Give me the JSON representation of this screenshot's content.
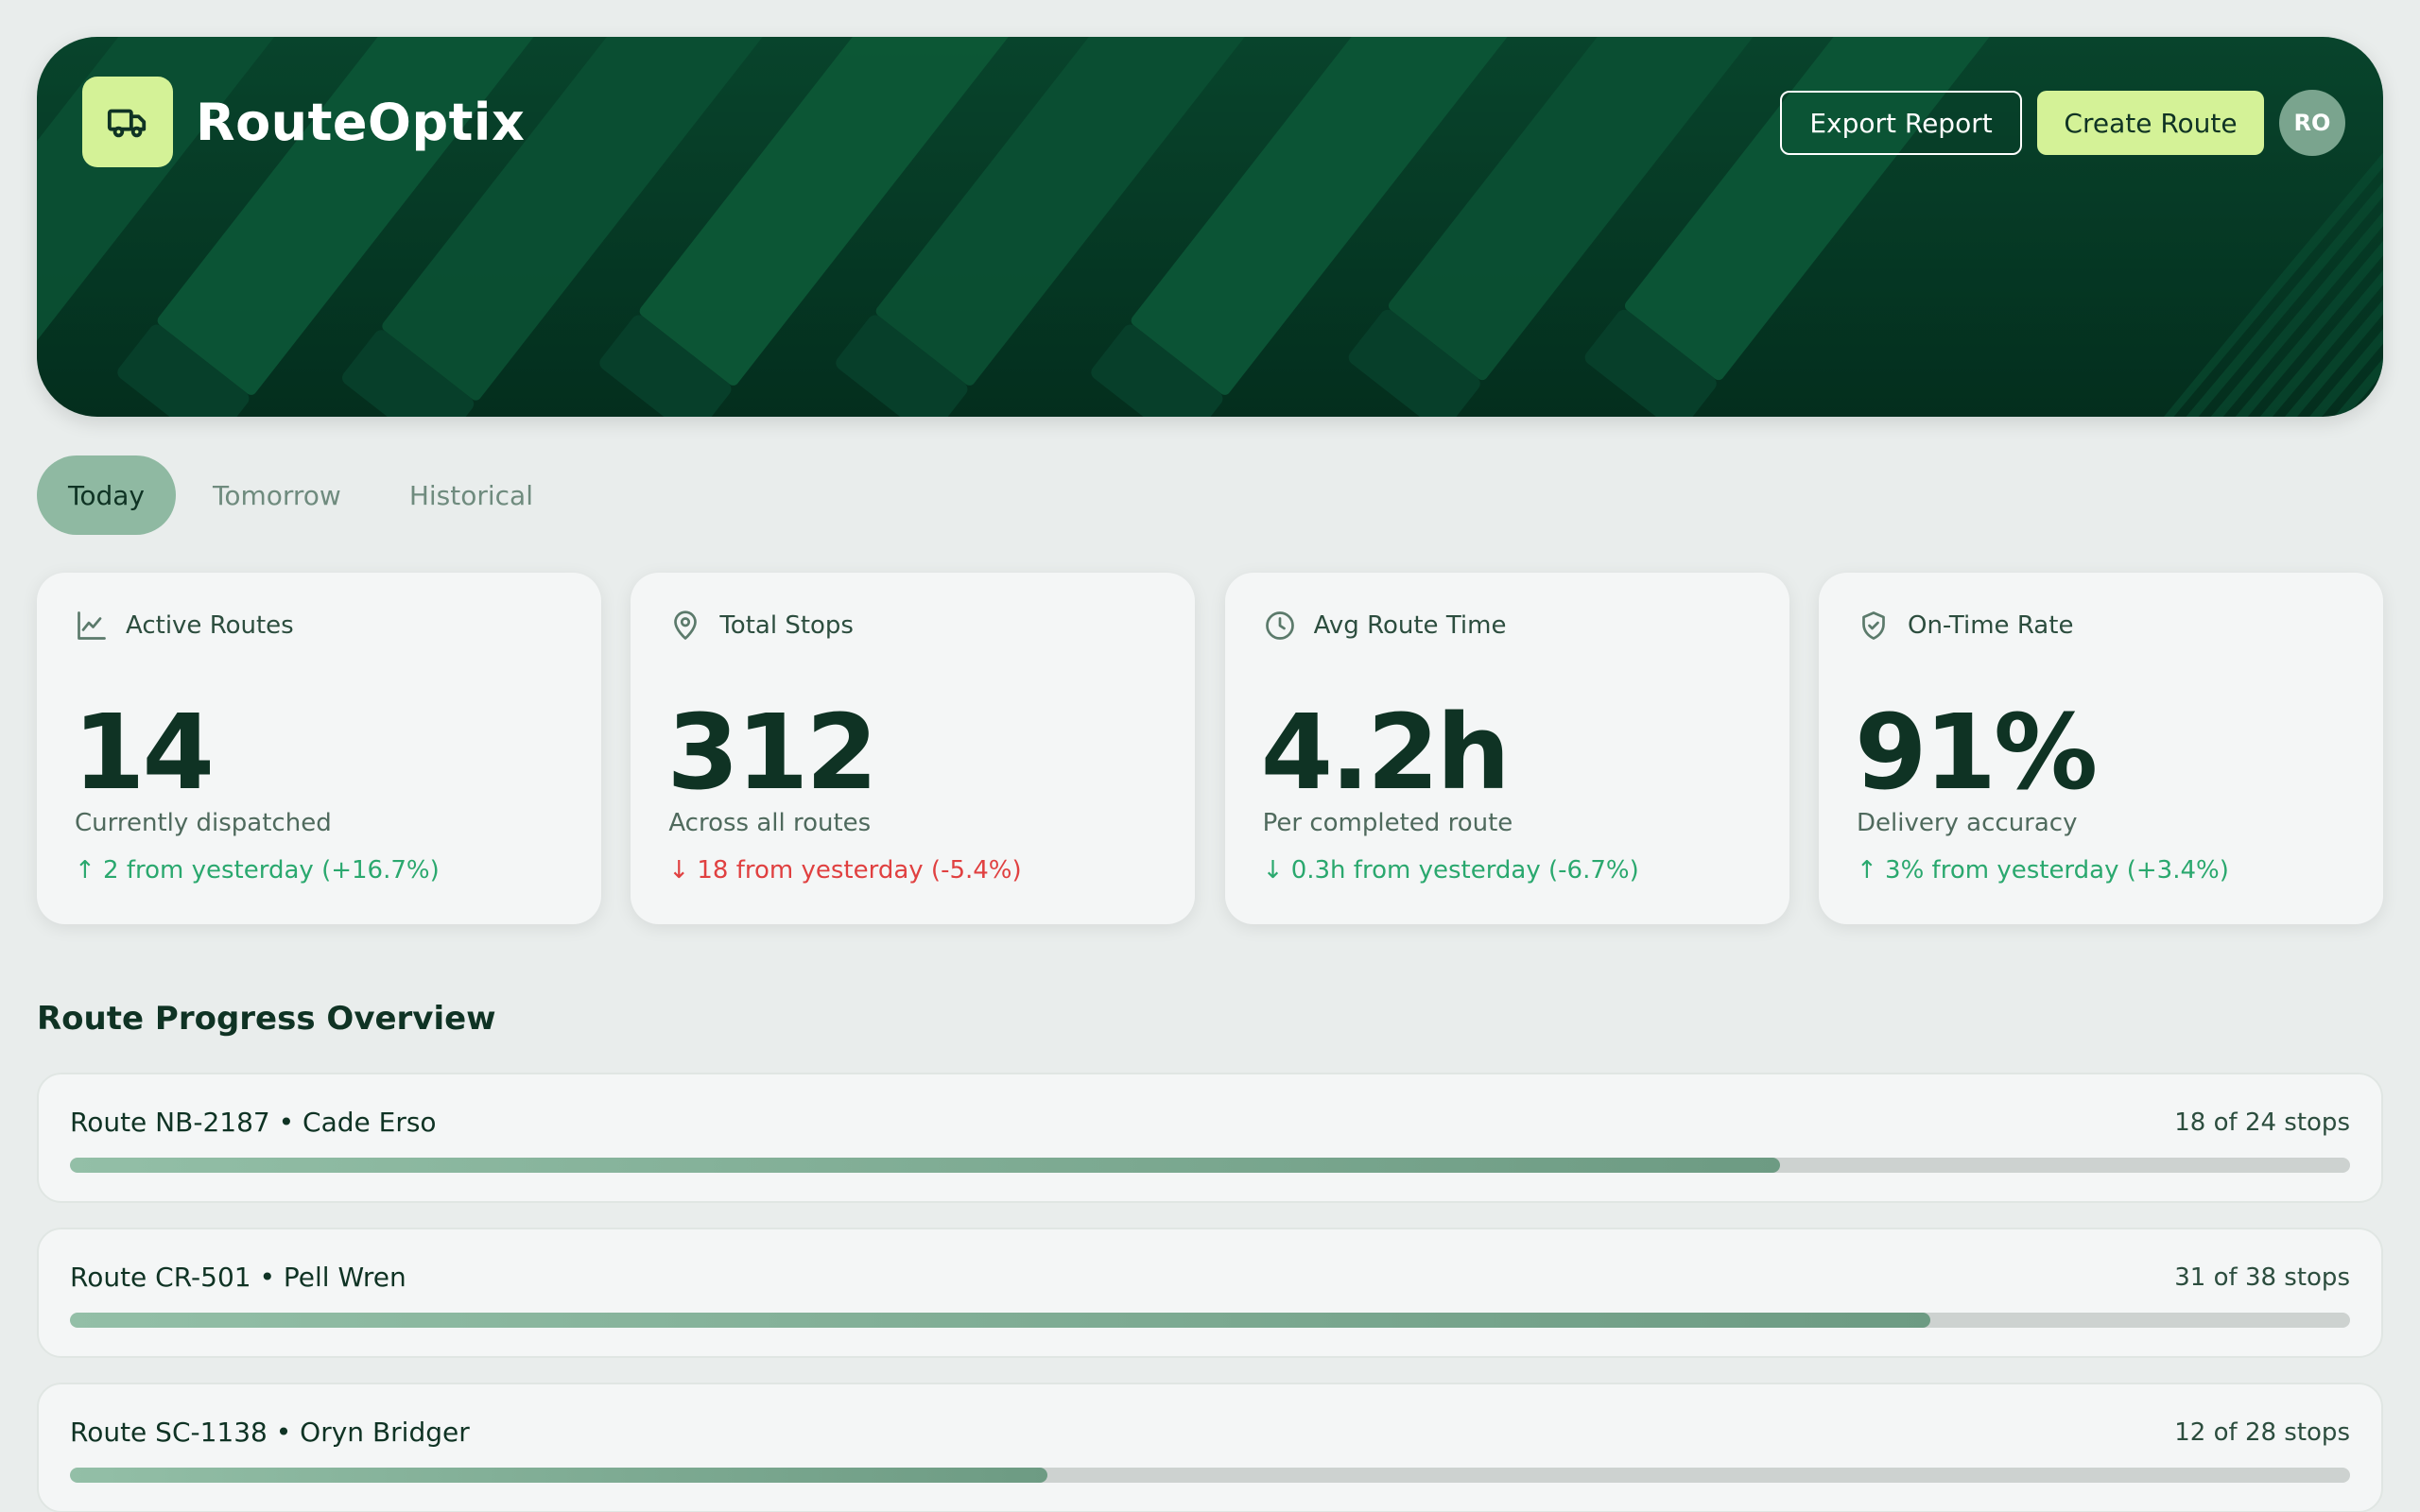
{
  "app": {
    "name": "RouteOptix"
  },
  "header": {
    "export_label": "Export Report",
    "create_label": "Create Route",
    "avatar_initials": "RO"
  },
  "tabs": [
    {
      "label": "Today",
      "active": true
    },
    {
      "label": "Tomorrow",
      "active": false
    },
    {
      "label": "Historical",
      "active": false
    }
  ],
  "stats": [
    {
      "icon": "line-chart-icon",
      "title": "Active Routes",
      "value": "14",
      "subtitle": "Currently dispatched",
      "delta": "↑ 2 from yesterday (+16.7%)",
      "trend": "up"
    },
    {
      "icon": "map-pin-icon",
      "title": "Total Stops",
      "value": "312",
      "subtitle": "Across all routes",
      "delta": "↓ 18 from yesterday (-5.4%)",
      "trend": "down"
    },
    {
      "icon": "clock-icon",
      "title": "Avg Route Time",
      "value": "4.2h",
      "subtitle": "Per completed route",
      "delta": "↓ 0.3h from yesterday (-6.7%)",
      "trend": "up"
    },
    {
      "icon": "shield-check-icon",
      "title": "On-Time Rate",
      "value": "91%",
      "subtitle": "Delivery accuracy",
      "delta": "↑ 3% from yesterday (+3.4%)",
      "trend": "up"
    }
  ],
  "progress": {
    "title": "Route Progress Overview",
    "routes": [
      {
        "name": "Route NB-2187 • Cade Erso",
        "stops_label": "18 of 24 stops",
        "completed": 18,
        "total": 24
      },
      {
        "name": "Route CR-501 • Pell Wren",
        "stops_label": "31 of 38 stops",
        "completed": 31,
        "total": 38
      },
      {
        "name": "Route SC-1138 • Oryn Bridger",
        "stops_label": "12 of 28 stops",
        "completed": 12,
        "total": 28
      }
    ]
  },
  "colors": {
    "accent": "#d4f297",
    "hero_green": "#063a25",
    "positive": "#2aa86e",
    "negative": "#e04040",
    "progress_fill": "#6d9b83"
  }
}
